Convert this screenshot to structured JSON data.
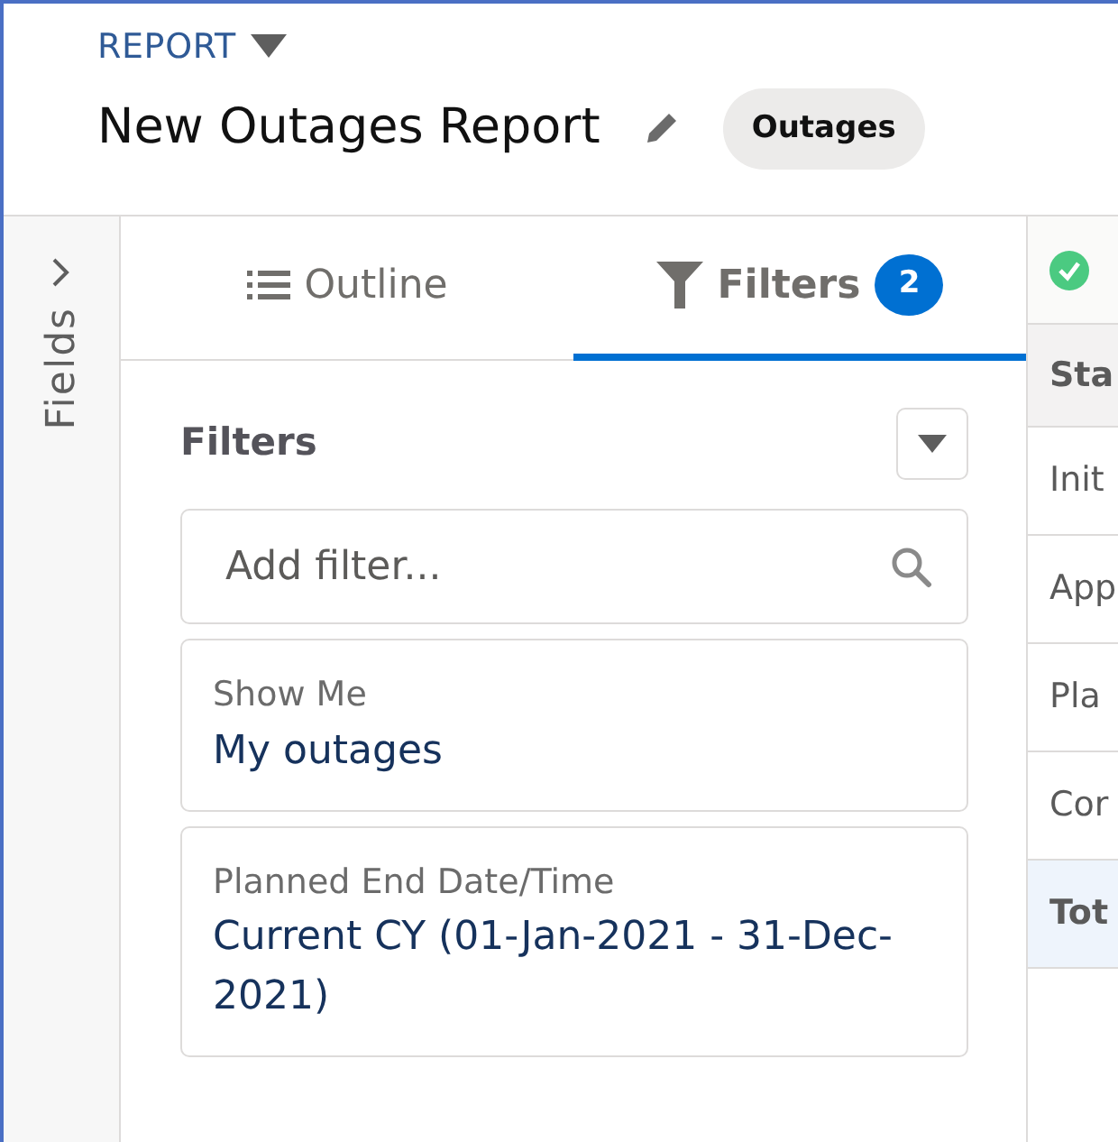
{
  "header": {
    "type_label": "REPORT",
    "title": "New Outages Report",
    "report_type": "Outages"
  },
  "fields_rail": {
    "label": "Fields"
  },
  "tabs": [
    {
      "label": "Outline",
      "kind": "outline",
      "selected": false
    },
    {
      "label": "Filters",
      "kind": "filters",
      "selected": true,
      "count": "2"
    }
  ],
  "filters_panel": {
    "title": "Filters",
    "search": {
      "placeholder": "Add filter..."
    },
    "filters": [
      {
        "label": "Show Me",
        "value": "My outages"
      },
      {
        "label": "Planned End Date/Time",
        "value": "Current CY (01-Jan-2021 - 31-Dec-2021)"
      }
    ]
  },
  "table": {
    "header": "Sta",
    "rows": [
      "Init",
      "App",
      "Pla",
      "Cor"
    ],
    "total": "Tot"
  }
}
